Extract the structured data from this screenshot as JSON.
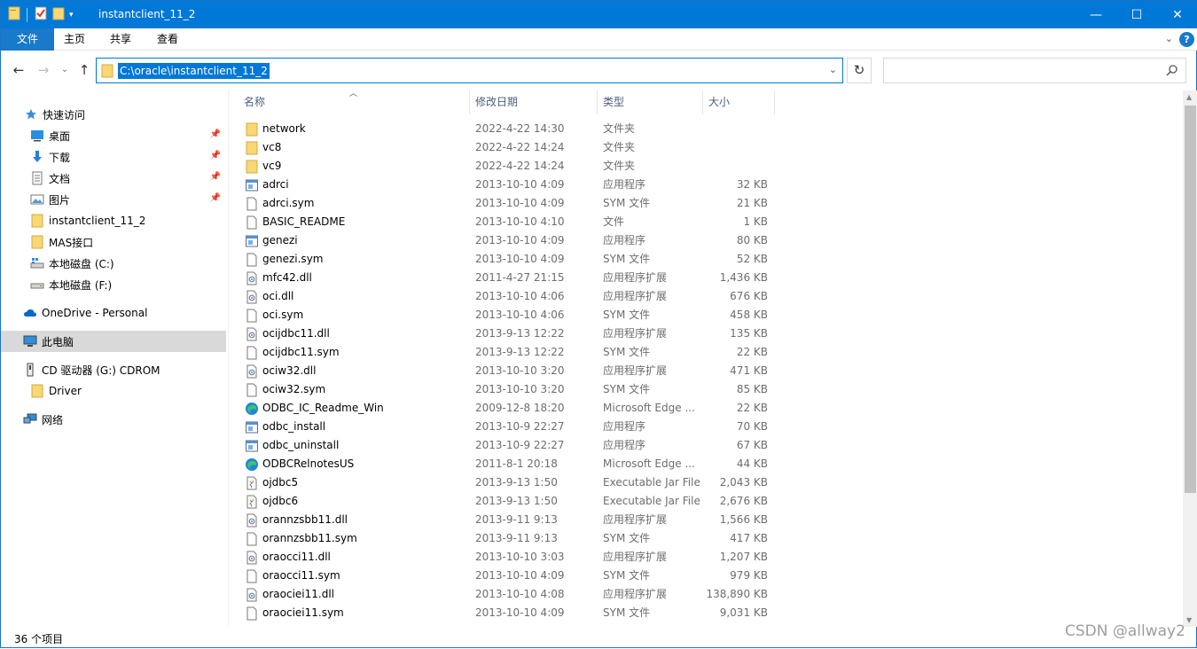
{
  "window": {
    "title": "instantclient_11_2",
    "minimize_glyph": "—",
    "maximize_glyph": "☐",
    "close_glyph": "✕"
  },
  "ribbon": {
    "tabs": [
      "文件",
      "主页",
      "共享",
      "查看"
    ],
    "help_glyph": "?",
    "collapse_glyph": "⌄"
  },
  "navigation": {
    "back_glyph": "←",
    "forward_glyph": "→",
    "recent_glyph": "⌄",
    "up_glyph": "↑",
    "address": "C:\\oracle\\instantclient_11_2",
    "address_dropdown_glyph": "⌄",
    "refresh_glyph": "↻",
    "search_placeholder": ""
  },
  "sidebar": {
    "items": [
      {
        "label": "快速访问",
        "icon": "star-icon"
      },
      {
        "label": "桌面",
        "icon": "desktop-icon",
        "pinned": true
      },
      {
        "label": "下载",
        "icon": "download-icon",
        "pinned": true
      },
      {
        "label": "文档",
        "icon": "document-icon",
        "pinned": true
      },
      {
        "label": "图片",
        "icon": "picture-icon",
        "pinned": true
      },
      {
        "label": "instantclient_11_2",
        "icon": "folder-icon"
      },
      {
        "label": "MAS接口",
        "icon": "folder-icon"
      },
      {
        "label": "本地磁盘 (C:)",
        "icon": "drive-windows-icon"
      },
      {
        "label": "本地磁盘 (F:)",
        "icon": "drive-icon"
      },
      {
        "label": "OneDrive - Personal",
        "icon": "cloud-icon"
      },
      {
        "label": "此电脑",
        "icon": "computer-icon",
        "selected": true
      },
      {
        "label": "CD 驱动器 (G:) CDROM",
        "icon": "cd-drive-icon"
      },
      {
        "label": "Driver",
        "icon": "folder-icon"
      },
      {
        "label": "网络",
        "icon": "network-icon"
      }
    ]
  },
  "columns": {
    "name": "名称",
    "date": "修改日期",
    "type": "类型",
    "size": "大小"
  },
  "files": [
    {
      "name": "network",
      "date": "2022-4-22 14:30",
      "type": "文件夹",
      "size": "",
      "icon": "folder-icon"
    },
    {
      "name": "vc8",
      "date": "2022-4-22 14:24",
      "type": "文件夹",
      "size": "",
      "icon": "folder-icon"
    },
    {
      "name": "vc9",
      "date": "2022-4-22 14:24",
      "type": "文件夹",
      "size": "",
      "icon": "folder-icon"
    },
    {
      "name": "adrci",
      "date": "2013-10-10 4:09",
      "type": "应用程序",
      "size": "32 KB",
      "icon": "application-icon"
    },
    {
      "name": "adrci.sym",
      "date": "2013-10-10 4:09",
      "type": "SYM 文件",
      "size": "21 KB",
      "icon": "file-icon"
    },
    {
      "name": "BASIC_README",
      "date": "2013-10-10 4:10",
      "type": "文件",
      "size": "1 KB",
      "icon": "file-icon"
    },
    {
      "name": "genezi",
      "date": "2013-10-10 4:09",
      "type": "应用程序",
      "size": "80 KB",
      "icon": "application-icon"
    },
    {
      "name": "genezi.sym",
      "date": "2013-10-10 4:09",
      "type": "SYM 文件",
      "size": "52 KB",
      "icon": "file-icon"
    },
    {
      "name": "mfc42.dll",
      "date": "2011-4-27 21:15",
      "type": "应用程序扩展",
      "size": "1,436 KB",
      "icon": "dll-icon"
    },
    {
      "name": "oci.dll",
      "date": "2013-10-10 4:06",
      "type": "应用程序扩展",
      "size": "676 KB",
      "icon": "dll-icon"
    },
    {
      "name": "oci.sym",
      "date": "2013-10-10 4:06",
      "type": "SYM 文件",
      "size": "458 KB",
      "icon": "file-icon"
    },
    {
      "name": "ocijdbc11.dll",
      "date": "2013-9-13 12:22",
      "type": "应用程序扩展",
      "size": "135 KB",
      "icon": "dll-icon"
    },
    {
      "name": "ocijdbc11.sym",
      "date": "2013-9-13 12:22",
      "type": "SYM 文件",
      "size": "22 KB",
      "icon": "file-icon"
    },
    {
      "name": "ociw32.dll",
      "date": "2013-10-10 3:20",
      "type": "应用程序扩展",
      "size": "471 KB",
      "icon": "dll-icon"
    },
    {
      "name": "ociw32.sym",
      "date": "2013-10-10 3:20",
      "type": "SYM 文件",
      "size": "85 KB",
      "icon": "file-icon"
    },
    {
      "name": "ODBC_IC_Readme_Win",
      "date": "2009-12-8 18:20",
      "type": "Microsoft Edge ...",
      "size": "22 KB",
      "icon": "edge-icon"
    },
    {
      "name": "odbc_install",
      "date": "2013-10-9 22:27",
      "type": "应用程序",
      "size": "70 KB",
      "icon": "application-icon"
    },
    {
      "name": "odbc_uninstall",
      "date": "2013-10-9 22:27",
      "type": "应用程序",
      "size": "67 KB",
      "icon": "application-icon"
    },
    {
      "name": "ODBCRelnotesUS",
      "date": "2011-8-1 20:18",
      "type": "Microsoft Edge ...",
      "size": "44 KB",
      "icon": "edge-icon"
    },
    {
      "name": "ojdbc5",
      "date": "2013-9-13 1:50",
      "type": "Executable Jar File",
      "size": "2,043 KB",
      "icon": "jar-icon"
    },
    {
      "name": "ojdbc6",
      "date": "2013-9-13 1:50",
      "type": "Executable Jar File",
      "size": "2,676 KB",
      "icon": "jar-icon"
    },
    {
      "name": "orannzsbb11.dll",
      "date": "2013-9-11 9:13",
      "type": "应用程序扩展",
      "size": "1,566 KB",
      "icon": "dll-icon"
    },
    {
      "name": "orannzsbb11.sym",
      "date": "2013-9-11 9:13",
      "type": "SYM 文件",
      "size": "417 KB",
      "icon": "file-icon"
    },
    {
      "name": "oraocci11.dll",
      "date": "2013-10-10 3:03",
      "type": "应用程序扩展",
      "size": "1,207 KB",
      "icon": "dll-icon"
    },
    {
      "name": "oraocci11.sym",
      "date": "2013-10-10 4:09",
      "type": "SYM 文件",
      "size": "979 KB",
      "icon": "file-icon"
    },
    {
      "name": "oraociei11.dll",
      "date": "2013-10-10 4:08",
      "type": "应用程序扩展",
      "size": "138,890 KB",
      "icon": "dll-icon"
    },
    {
      "name": "oraociei11.sym",
      "date": "2013-10-10 4:09",
      "type": "SYM 文件",
      "size": "9,031 KB",
      "icon": "file-icon"
    }
  ],
  "status": {
    "item_count": "36 个项目"
  },
  "watermark": "CSDN @allway2",
  "colors": {
    "titlebar": "#0078d7",
    "file_tab": "#1979ca",
    "selection": "#0078d7",
    "folder": "#f8d775"
  }
}
